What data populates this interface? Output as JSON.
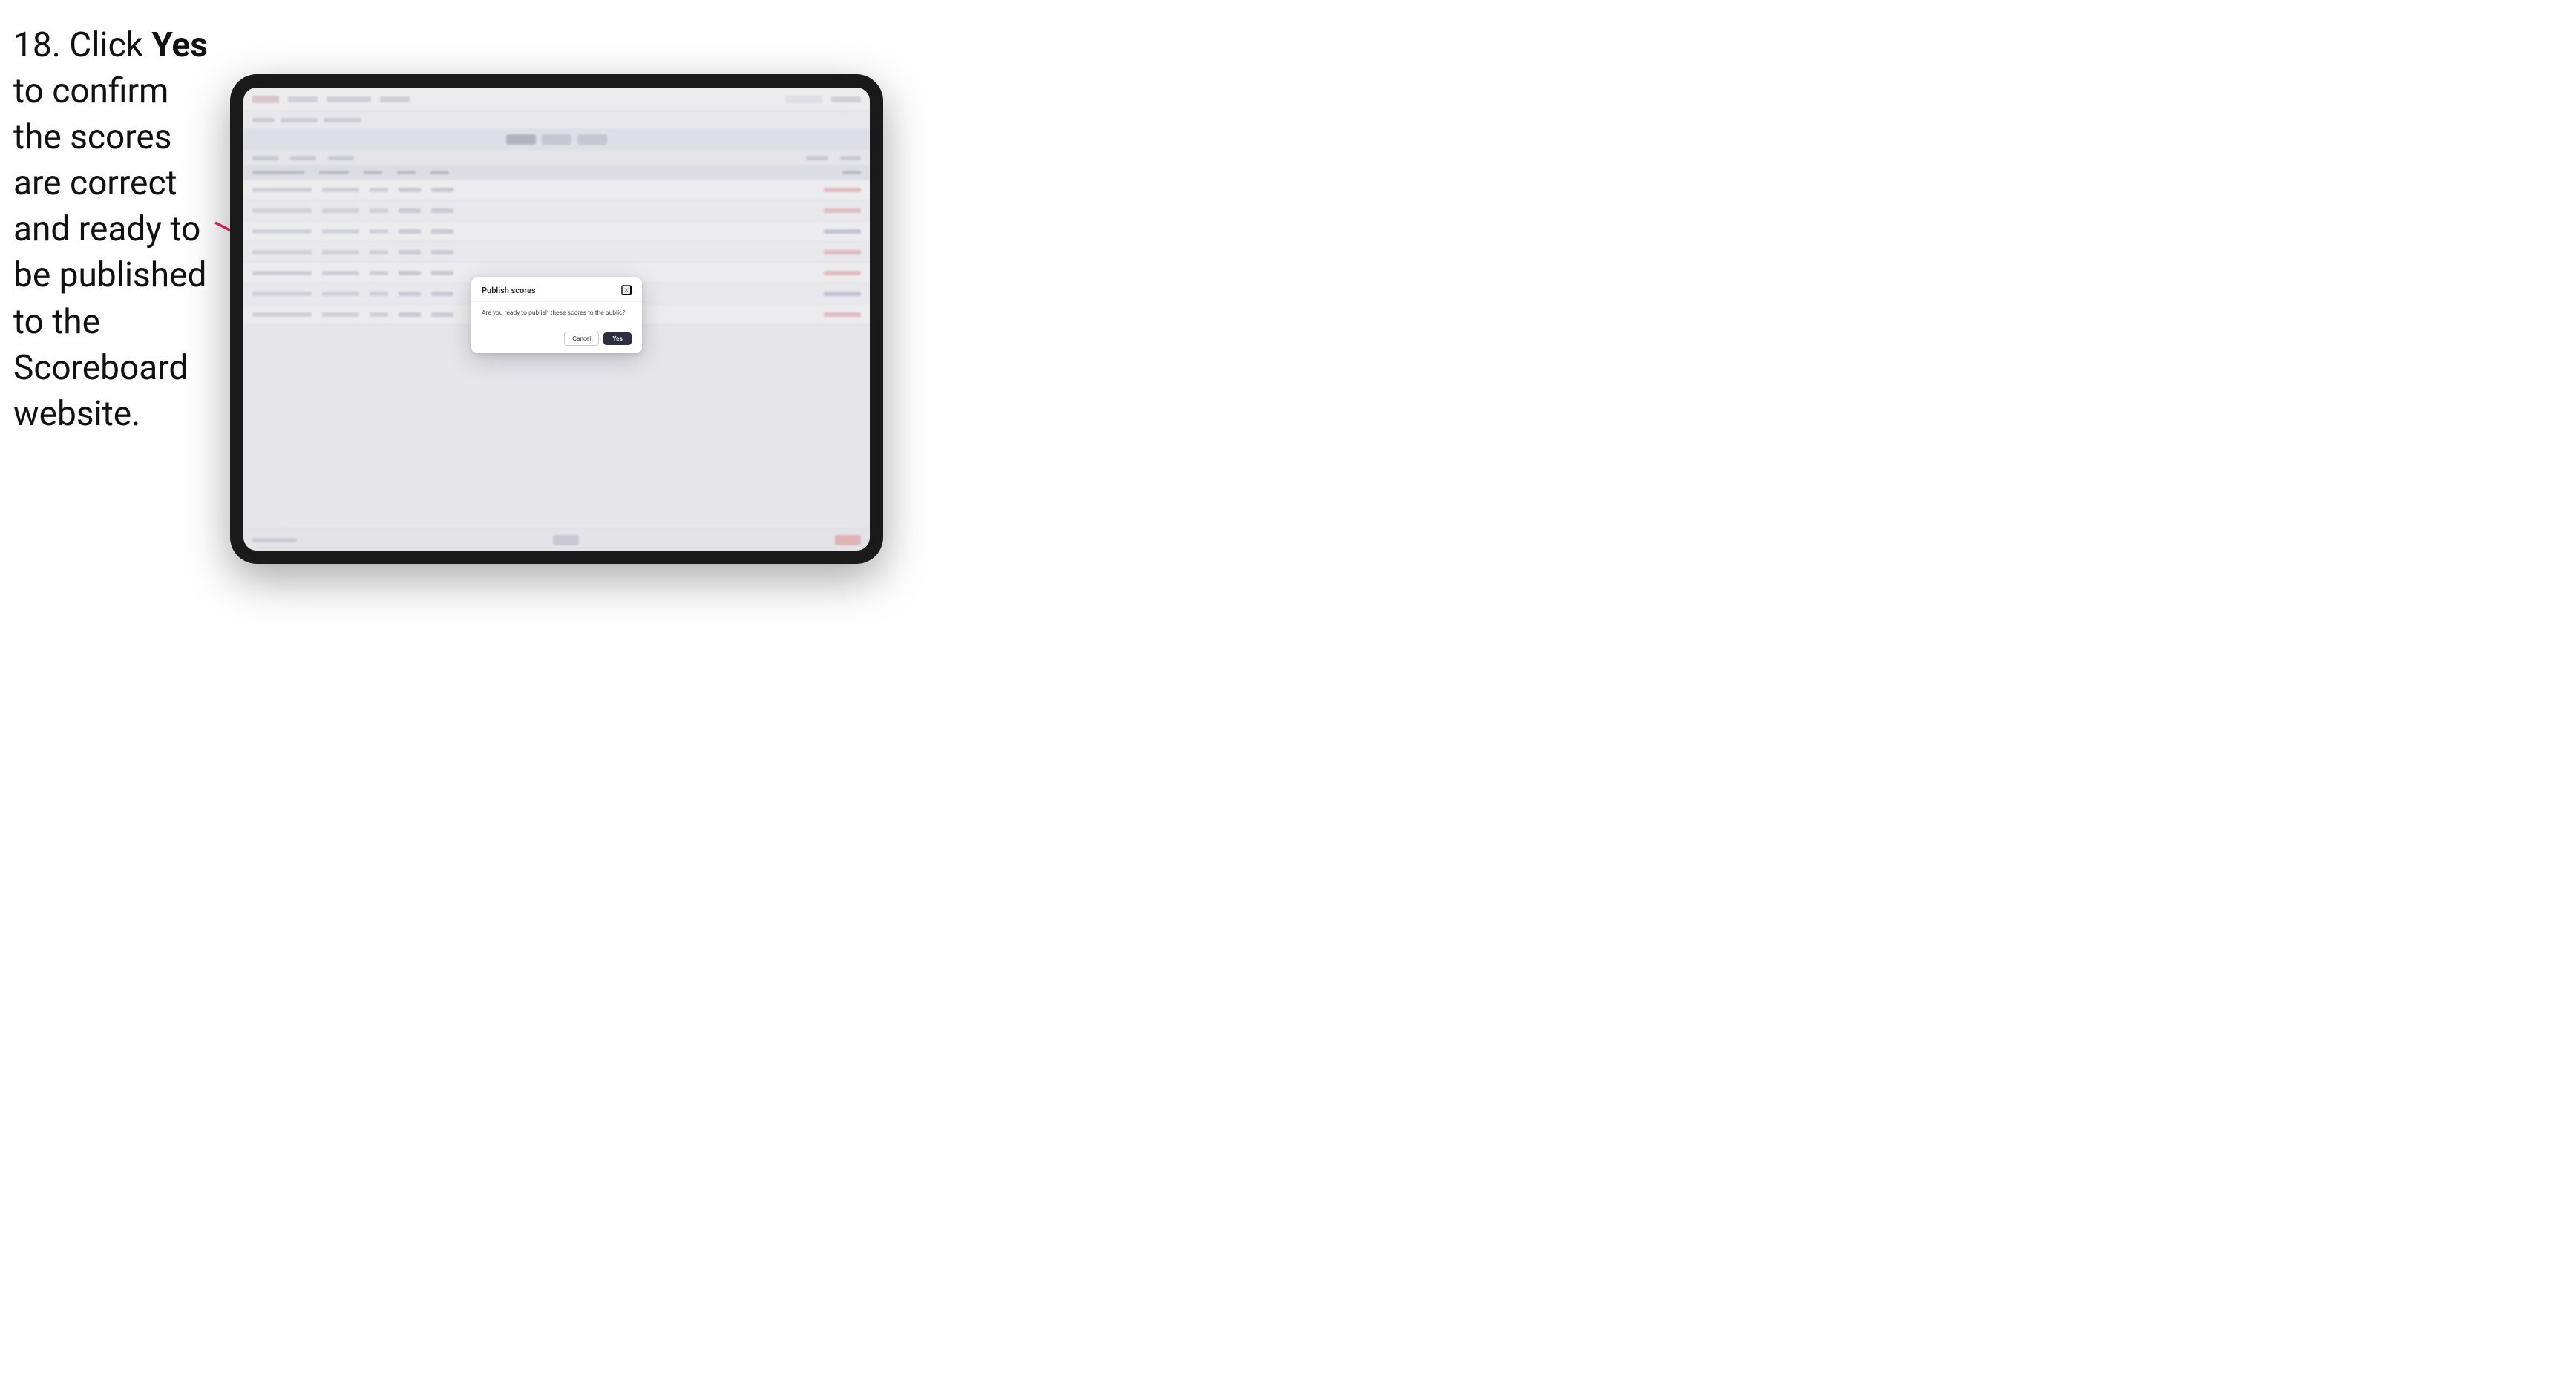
{
  "instruction": {
    "step": "18.",
    "text_before_bold": "Click ",
    "bold": "Yes",
    "text_after": " to confirm the scores are correct and ready to be published to the Scoreboard website."
  },
  "modal": {
    "title": "Publish scores",
    "message": "Are you ready to publish these scores to the public?",
    "close_label": "×",
    "cancel_label": "Cancel",
    "yes_label": "Yes"
  },
  "background": {
    "rows": [
      {
        "cells": [
          "wide",
          "",
          "narrow",
          "number",
          "number",
          "red"
        ]
      },
      {
        "cells": [
          "wide",
          "",
          "narrow",
          "number",
          "number",
          "red"
        ]
      },
      {
        "cells": [
          "wide",
          "",
          "narrow",
          "number",
          "number",
          "accent"
        ]
      },
      {
        "cells": [
          "wide",
          "",
          "narrow",
          "number",
          "number",
          "red"
        ]
      },
      {
        "cells": [
          "wide",
          "",
          "narrow",
          "number",
          "number",
          "red"
        ]
      },
      {
        "cells": [
          "wide",
          "",
          "narrow",
          "number",
          "number",
          "accent"
        ]
      },
      {
        "cells": [
          "wide",
          "",
          "narrow",
          "number",
          "number",
          "red"
        ]
      }
    ]
  }
}
